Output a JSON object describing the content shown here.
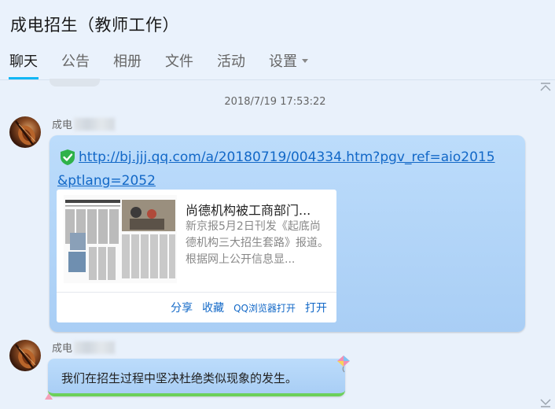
{
  "header": {
    "title": "成电招生（教师工作）",
    "tabs": [
      {
        "label": "聊天",
        "active": true
      },
      {
        "label": "公告"
      },
      {
        "label": "相册"
      },
      {
        "label": "文件"
      },
      {
        "label": "活动"
      },
      {
        "label": "设置",
        "has_dropdown": true
      }
    ]
  },
  "messages": {
    "timestamp": "2018/7/19 17:53:22",
    "items": [
      {
        "sender": "成电",
        "link": "http://bj.jjj.qq.com/a/20180719/004334.htm?pgv_ref=aio2015&ptlang=2052",
        "card": {
          "title": "尚德机构被工商部门...",
          "description": "新京报5月2日刊发《起底尚德机构三大招生套路》报道。根据网上公开信息显...",
          "actions": [
            "分享",
            "收藏",
            "QQ浏览器打开",
            "打开"
          ]
        }
      },
      {
        "sender": "成电",
        "text": "我们在招生过程中坚决杜绝类似现象的发生。"
      }
    ]
  },
  "colors": {
    "accent": "#12b7f5",
    "link": "#1268c7",
    "bubble": "#b3d5f8",
    "bubble_underline": "#6cd05a"
  }
}
